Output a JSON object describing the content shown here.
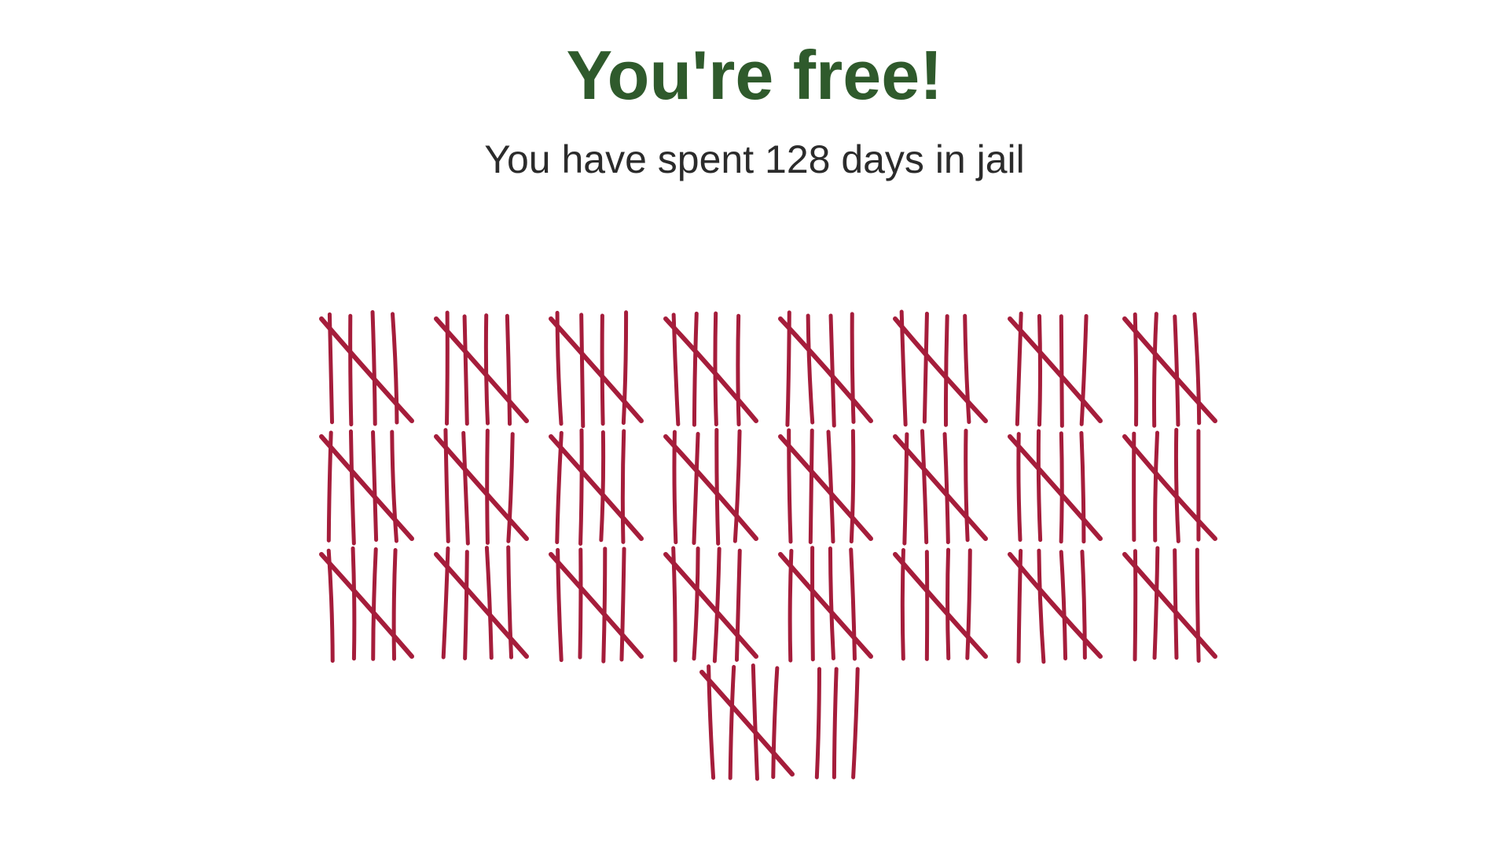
{
  "headline": "You're free!",
  "message": "You have spent 128 days in jail",
  "tally": {
    "days": 128,
    "group_size": 5,
    "groups_per_row": 8
  },
  "colors": {
    "headline": "#2f5a2c",
    "text": "#2b2b2b",
    "tally_mark": "#a51d3b"
  }
}
